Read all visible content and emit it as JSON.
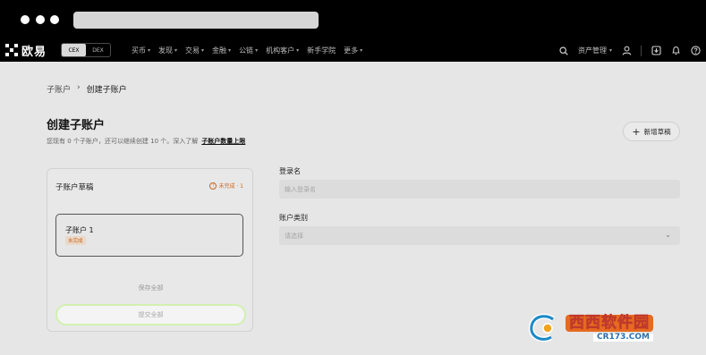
{
  "nav": {
    "logo_text": "欧易",
    "toggle": [
      "CEX",
      "DEX"
    ],
    "menu": [
      "买币",
      "发现",
      "交易",
      "金融",
      "公链",
      "机构客户",
      "新手学院",
      "更多"
    ],
    "menu_has_chevron": [
      true,
      true,
      true,
      true,
      true,
      true,
      false,
      true
    ],
    "asset_label": "资产管理"
  },
  "breadcrumb": {
    "parent": "子账户",
    "separator": "›",
    "current": "创建子账户"
  },
  "page": {
    "title": "创建子账户",
    "subtitle": "您现有 0 个子账户，还可以继续创建 10 个。深入了解",
    "subtitle_link": "子账户数量上限",
    "add_draft_label": "新增草稿"
  },
  "drafts": {
    "title": "子账户草稿",
    "status": "未完成 · 1",
    "card_title": "子账户 1",
    "card_badge": "未完成",
    "save_all": "保存全部",
    "submit_all": "提交全部"
  },
  "form": {
    "login_label": "登录名",
    "login_placeholder": "输入登录名",
    "type_label": "账户类别",
    "type_placeholder": "请选择"
  },
  "watermark": {
    "brand": "西西软件园",
    "url": "CR173.COM"
  },
  "colors": {
    "accent_green": "#d2f0b0",
    "warning": "#c9661f",
    "nav_bg": "#000000"
  }
}
